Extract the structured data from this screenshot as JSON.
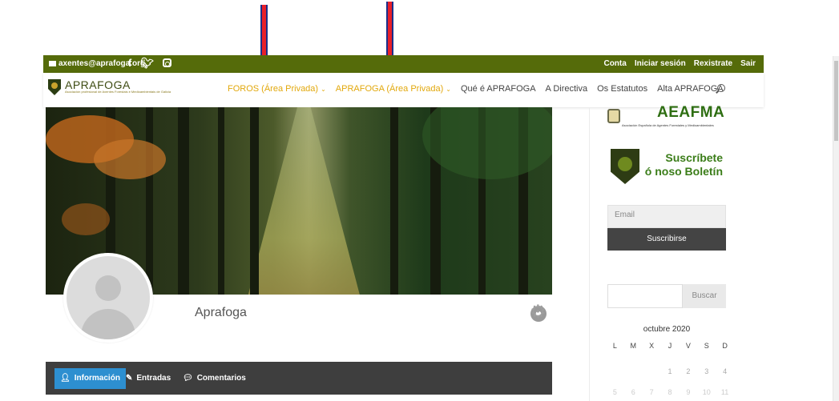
{
  "topbar": {
    "email": "axentes@aprafoga.org",
    "social_icons": [
      "facebook-icon",
      "twitter-icon",
      "instagram-icon"
    ],
    "links": [
      "Conta",
      "Iniciar sesión",
      "Rexistrate",
      "Sair"
    ],
    "color": "#556b0a"
  },
  "nav": {
    "logo_name": "APRAFOGA",
    "logo_subtitle": "Asociación profesional de Axentes Forestais e Medioambientais de Galicia",
    "menu": [
      {
        "label": "FOROS (Área Privada)",
        "dropdown": true,
        "highlight": true
      },
      {
        "label": "APRAFOGA (Área Privada)",
        "dropdown": true,
        "highlight": true
      },
      {
        "label": "Qué é APRAFOGA"
      },
      {
        "label": "A Directiva"
      },
      {
        "label": "Os Estatutos"
      },
      {
        "label": "Alta APRAFOGA"
      }
    ],
    "highlight_color": "#e2a80c"
  },
  "profile": {
    "name": "Aprafoga",
    "tabs": [
      "Información",
      "Entradas",
      "Comentarios"
    ],
    "active_tab_color": "#2d8fd0"
  },
  "sidebar": {
    "aeafma_name": "AEAFMA",
    "aeafma_subtitle": "Asociación Española de Agentes Forestales y Medioambientales",
    "newsletter_line1": "Suscríbete",
    "newsletter_line2": "ó noso Boletín",
    "email_placeholder": "Email",
    "subscribe_label": "Suscribirse",
    "search_label": "Buscar",
    "calendar_title": "octubre 2020",
    "weekdays": [
      "L",
      "M",
      "X",
      "J",
      "V",
      "S",
      "D"
    ],
    "week1": [
      "",
      "",
      "",
      "1",
      "2",
      "3",
      "4"
    ],
    "week2": [
      "5",
      "6",
      "7",
      "8",
      "9",
      "10",
      "11"
    ]
  }
}
